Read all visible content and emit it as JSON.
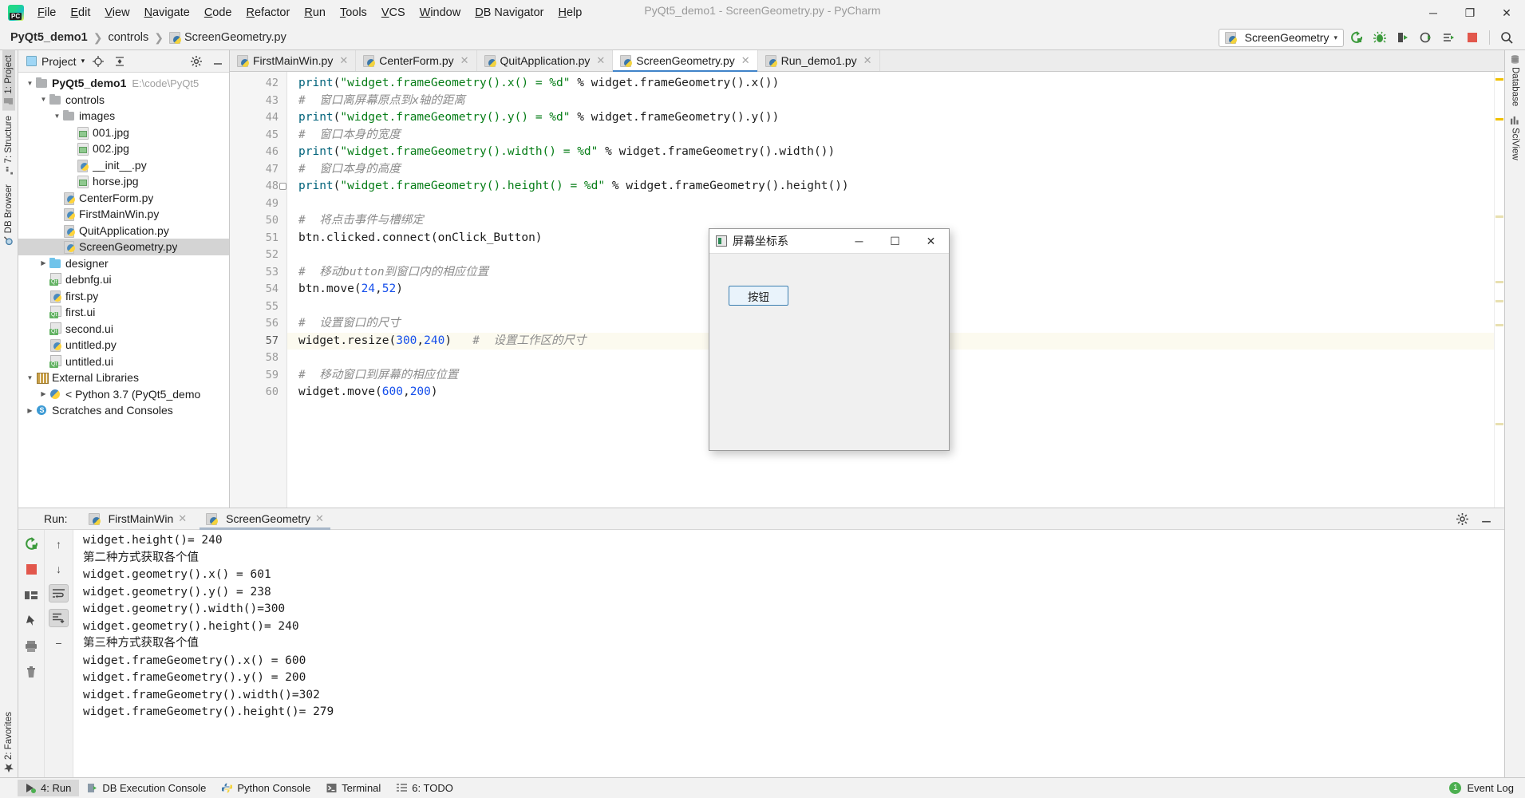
{
  "window": {
    "title": "PyQt5_demo1 - ScreenGeometry.py - PyCharm",
    "minimize": "─",
    "maximize": "❐",
    "close": "✕"
  },
  "menu": {
    "items": [
      "File",
      "Edit",
      "View",
      "Navigate",
      "Code",
      "Refactor",
      "Run",
      "Tools",
      "VCS",
      "Window",
      "DB Navigator",
      "Help"
    ]
  },
  "breadcrumb": {
    "project": "PyQt5_demo1",
    "folder": "controls",
    "file": "ScreenGeometry.py"
  },
  "toolbar": {
    "run_config": "ScreenGeometry",
    "caret": "▾",
    "run_icon": "run-icon",
    "debug_icon": "debug-icon",
    "coverage_icon": "coverage-icon",
    "profile_icon": "profile-icon",
    "attach_icon": "attach-icon",
    "stop_icon": "stop-icon",
    "search_icon": "search-icon"
  },
  "left_rail": {
    "items": [
      {
        "label": "1: Project",
        "icon": "project-icon",
        "active": true
      },
      {
        "label": "7: Structure",
        "icon": "structure-icon",
        "active": false
      },
      {
        "label": "DB Browser",
        "icon": "database-browser-icon",
        "active": false
      }
    ],
    "bottom": [
      {
        "label": "2: Favorites",
        "icon": "star-icon",
        "active": false
      }
    ]
  },
  "right_rail": {
    "items": [
      {
        "label": "Database",
        "icon": "database-icon"
      },
      {
        "label": "SciView",
        "icon": "sciview-icon"
      }
    ]
  },
  "project_panel": {
    "title": "Project",
    "caret": "▾",
    "locate_icon": "locate-icon",
    "collapse_icon": "collapse-all-icon",
    "settings_icon": "gear-icon",
    "hide_icon": "hide-icon",
    "tree": [
      {
        "label": "PyQt5_demo1",
        "path": "E:\\code\\PyQt5",
        "icon": "folder",
        "depth": 0,
        "arrow": "▼",
        "bold": true,
        "selected": false
      },
      {
        "label": "controls",
        "path": "",
        "icon": "folder",
        "depth": 1,
        "arrow": "▼",
        "bold": false,
        "selected": false
      },
      {
        "label": "images",
        "path": "",
        "icon": "folder",
        "depth": 2,
        "arrow": "▼",
        "bold": false,
        "selected": false
      },
      {
        "label": "001.jpg",
        "path": "",
        "icon": "image",
        "depth": 3,
        "arrow": "",
        "bold": false,
        "selected": false
      },
      {
        "label": "002.jpg",
        "path": "",
        "icon": "image",
        "depth": 3,
        "arrow": "",
        "bold": false,
        "selected": false
      },
      {
        "label": "__init__.py",
        "path": "",
        "icon": "python",
        "depth": 3,
        "arrow": "",
        "bold": false,
        "selected": false
      },
      {
        "label": "horse.jpg",
        "path": "",
        "icon": "image",
        "depth": 3,
        "arrow": "",
        "bold": false,
        "selected": false
      },
      {
        "label": "CenterForm.py",
        "path": "",
        "icon": "python",
        "depth": 2,
        "arrow": "",
        "bold": false,
        "selected": false
      },
      {
        "label": "FirstMainWin.py",
        "path": "",
        "icon": "python",
        "depth": 2,
        "arrow": "",
        "bold": false,
        "selected": false
      },
      {
        "label": "QuitApplication.py",
        "path": "",
        "icon": "python",
        "depth": 2,
        "arrow": "",
        "bold": false,
        "selected": false
      },
      {
        "label": "ScreenGeometry.py",
        "path": "",
        "icon": "python",
        "depth": 2,
        "arrow": "",
        "bold": false,
        "selected": true
      },
      {
        "label": "designer",
        "path": "",
        "icon": "folder-blue",
        "depth": 1,
        "arrow": "▶",
        "bold": false,
        "selected": false
      },
      {
        "label": "debnfg.ui",
        "path": "",
        "icon": "ui",
        "depth": 1,
        "arrow": "",
        "bold": false,
        "selected": false
      },
      {
        "label": "first.py",
        "path": "",
        "icon": "python",
        "depth": 1,
        "arrow": "",
        "bold": false,
        "selected": false
      },
      {
        "label": "first.ui",
        "path": "",
        "icon": "ui",
        "depth": 1,
        "arrow": "",
        "bold": false,
        "selected": false
      },
      {
        "label": "second.ui",
        "path": "",
        "icon": "ui",
        "depth": 1,
        "arrow": "",
        "bold": false,
        "selected": false
      },
      {
        "label": "untitled.py",
        "path": "",
        "icon": "python",
        "depth": 1,
        "arrow": "",
        "bold": false,
        "selected": false
      },
      {
        "label": "untitled.ui",
        "path": "",
        "icon": "ui",
        "depth": 1,
        "arrow": "",
        "bold": false,
        "selected": false
      },
      {
        "label": "External Libraries",
        "path": "",
        "icon": "library",
        "depth": 0,
        "arrow": "▼",
        "bold": false,
        "selected": false
      },
      {
        "label": "< Python 3.7 (PyQt5_demo",
        "path": "",
        "icon": "package",
        "depth": 1,
        "arrow": "▶",
        "bold": false,
        "selected": false
      },
      {
        "label": "Scratches and Consoles",
        "path": "",
        "icon": "scratch",
        "depth": 0,
        "arrow": "▶",
        "bold": false,
        "selected": false
      }
    ]
  },
  "editor": {
    "tabs": [
      {
        "label": "FirstMainWin.py",
        "active": false,
        "close": "✕"
      },
      {
        "label": "CenterForm.py",
        "active": false,
        "close": "✕"
      },
      {
        "label": "QuitApplication.py",
        "active": false,
        "close": "✕"
      },
      {
        "label": "ScreenGeometry.py",
        "active": true,
        "close": "✕"
      },
      {
        "label": "Run_demo1.py",
        "active": false,
        "close": "✕"
      }
    ],
    "first_line_number": 42,
    "highlighted_line": 57,
    "lines": [
      {
        "n": 42,
        "tokens": [
          {
            "t": "print",
            "c": "fn"
          },
          {
            "t": "(",
            "c": "p"
          },
          {
            "t": "\"widget.frameGeometry().x() = %d\"",
            "c": "s"
          },
          {
            "t": " % widget.frameGeometry().x())",
            "c": "p"
          }
        ]
      },
      {
        "n": 43,
        "tokens": [
          {
            "t": "#  窗口离屏幕原点到x轴的距离",
            "c": "c"
          }
        ]
      },
      {
        "n": 44,
        "tokens": [
          {
            "t": "print",
            "c": "fn"
          },
          {
            "t": "(",
            "c": "p"
          },
          {
            "t": "\"widget.frameGeometry().y() = %d\"",
            "c": "s"
          },
          {
            "t": " % widget.frameGeometry().y())",
            "c": "p"
          }
        ]
      },
      {
        "n": 45,
        "tokens": [
          {
            "t": "#  窗口本身的宽度",
            "c": "c"
          }
        ]
      },
      {
        "n": 46,
        "tokens": [
          {
            "t": "print",
            "c": "fn"
          },
          {
            "t": "(",
            "c": "p"
          },
          {
            "t": "\"widget.frameGeometry().width() = %d\"",
            "c": "s"
          },
          {
            "t": " % widget.frameGeometry().width())",
            "c": "p"
          }
        ]
      },
      {
        "n": 47,
        "tokens": [
          {
            "t": "#  窗口本身的高度",
            "c": "c"
          }
        ]
      },
      {
        "n": 48,
        "tokens": [
          {
            "t": "print",
            "c": "fn"
          },
          {
            "t": "(",
            "c": "p"
          },
          {
            "t": "\"widget.frameGeometry().height() = %d\"",
            "c": "s"
          },
          {
            "t": " % widget.frameGeometry().height())",
            "c": "p"
          }
        ]
      },
      {
        "n": 49,
        "tokens": []
      },
      {
        "n": 50,
        "tokens": [
          {
            "t": "#  将点击事件与槽绑定",
            "c": "c"
          }
        ]
      },
      {
        "n": 51,
        "tokens": [
          {
            "t": "btn.clicked.connect(onClick_Button)",
            "c": "p"
          }
        ]
      },
      {
        "n": 52,
        "tokens": []
      },
      {
        "n": 53,
        "tokens": [
          {
            "t": "#  移动button到窗口内的相应位置",
            "c": "c"
          }
        ]
      },
      {
        "n": 54,
        "tokens": [
          {
            "t": "btn.move(",
            "c": "p"
          },
          {
            "t": "24",
            "c": "n"
          },
          {
            "t": ",",
            "c": "p"
          },
          {
            "t": "52",
            "c": "n"
          },
          {
            "t": ")",
            "c": "p"
          }
        ]
      },
      {
        "n": 55,
        "tokens": []
      },
      {
        "n": 56,
        "tokens": [
          {
            "t": "#  设置窗口的尺寸",
            "c": "c"
          }
        ]
      },
      {
        "n": 57,
        "tokens": [
          {
            "t": "widget.resize(",
            "c": "p"
          },
          {
            "t": "300",
            "c": "n"
          },
          {
            "t": ",",
            "c": "p"
          },
          {
            "t": "240",
            "c": "n"
          },
          {
            "t": ")",
            "c": "p"
          },
          {
            "t": "   #  设置工作区的尺寸",
            "c": "c"
          }
        ]
      },
      {
        "n": 58,
        "tokens": []
      },
      {
        "n": 59,
        "tokens": [
          {
            "t": "#  移动窗口到屏幕的相应位置",
            "c": "c"
          }
        ]
      },
      {
        "n": 60,
        "tokens": [
          {
            "t": "widget.move(",
            "c": "p"
          },
          {
            "t": "600",
            "c": "n"
          },
          {
            "t": ",",
            "c": "p"
          },
          {
            "t": "200",
            "c": "n"
          },
          {
            "t": ")",
            "c": "p"
          }
        ]
      }
    ]
  },
  "qt_window": {
    "title": "屏幕坐标系",
    "button_label": "按钮",
    "minimize": "─",
    "maximize": "☐",
    "close": "✕"
  },
  "run_panel": {
    "label": "Run:",
    "tabs": [
      {
        "label": "FirstMainWin",
        "active": false,
        "close": "✕"
      },
      {
        "label": "ScreenGeometry",
        "active": true,
        "close": "✕"
      }
    ],
    "settings_icon": "gear-icon",
    "hide_icon": "hide-icon",
    "toolbar_left": [
      "rerun-icon",
      "stop-icon",
      "layout-icon",
      "pin-icon",
      "print-icon",
      "trash-icon"
    ],
    "toolbar_second": [
      "scroll-up-icon",
      "scroll-down-icon",
      "soft-wrap-icon",
      "scroll-to-end-icon",
      "minimize-icon"
    ],
    "output": [
      "widget.height()= 240",
      "第二种方式获取各个值",
      "widget.geometry().x() = 601",
      "widget.geometry().y() = 238",
      "widget.geometry().width()=300",
      "widget.geometry().height()= 240",
      "第三种方式获取各个值",
      "widget.frameGeometry().x() = 600",
      "widget.frameGeometry().y() = 200",
      "widget.frameGeometry().width()=302",
      "widget.frameGeometry().height()= 279"
    ]
  },
  "statusbar": {
    "items": [
      {
        "label": "4: Run",
        "icon": "run-icon",
        "active": true
      },
      {
        "label": "DB Execution Console",
        "icon": "db-console-icon",
        "active": false
      },
      {
        "label": "Python Console",
        "icon": "python-icon",
        "active": false
      },
      {
        "label": "Terminal",
        "icon": "terminal-icon",
        "active": false
      },
      {
        "label": "6: TODO",
        "icon": "todo-icon",
        "active": false
      }
    ],
    "event_log": "Event Log",
    "event_count": "1"
  },
  "colors": {
    "accent_blue": "#4083c9",
    "string_green": "#067d17",
    "number_blue": "#1750eb",
    "keyword_blue": "#0033b3",
    "comment_gray": "#8c8c8c",
    "selection_gray": "#d4d4d4",
    "highlight_line": "#fcfaef"
  }
}
